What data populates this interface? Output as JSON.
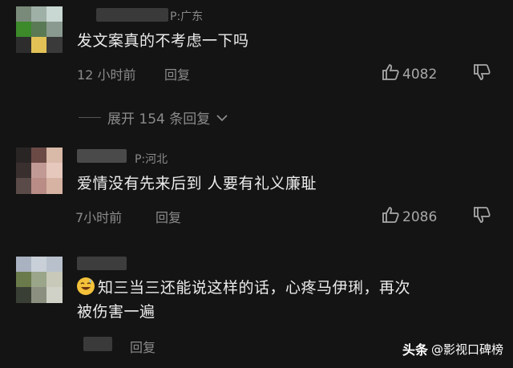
{
  "comments": [
    {
      "ip": "P:广东",
      "text": "发文案真的不考虑一下吗",
      "time": "12 小时前",
      "reply": "回复",
      "likes": "4082"
    },
    {
      "ip": "P:河北",
      "text": "爱情没有先来后到 人要有礼义廉耻",
      "time": "7小时前",
      "reply": "回复",
      "likes": "2086"
    },
    {
      "text_line1": "知三当三还能说这样的话，心疼马伊琍，再次",
      "text_line2": "被伤害一遍",
      "reply": "回复"
    }
  ],
  "expand_replies": "展开 154 条回复",
  "watermark": {
    "brand": "头条",
    "account": "@影视口碑榜"
  }
}
